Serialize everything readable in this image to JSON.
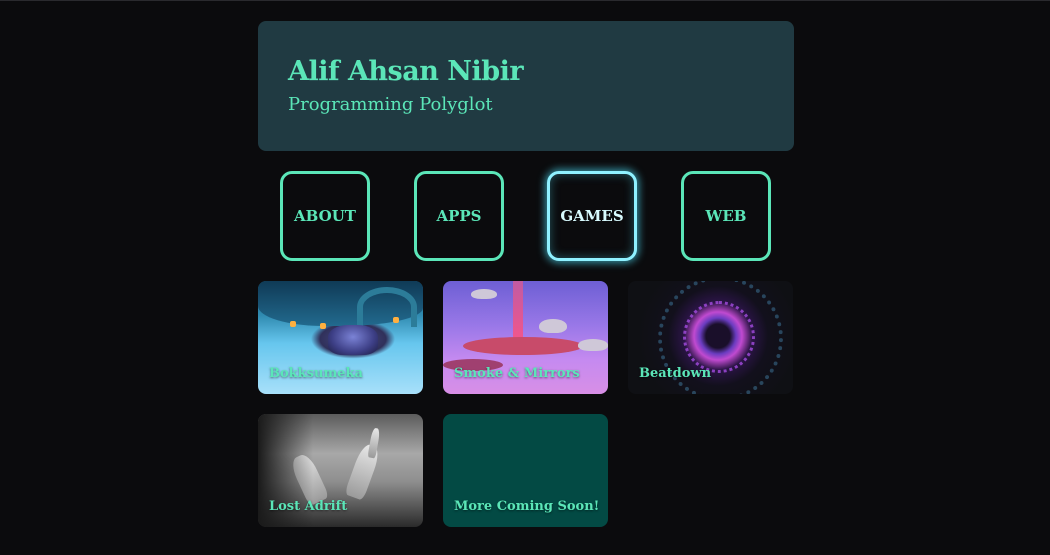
{
  "header": {
    "name": "Alif Ahsan Nibir",
    "tagline": "Programming Polyglot"
  },
  "nav": {
    "items": [
      {
        "label": "ABOUT",
        "active": false
      },
      {
        "label": "APPS",
        "active": false
      },
      {
        "label": "GAMES",
        "active": true
      },
      {
        "label": "WEB",
        "active": false
      }
    ]
  },
  "games": {
    "items": [
      {
        "title": "Bokksumeka"
      },
      {
        "title": "Smoke & Mirrors"
      },
      {
        "title": "Beatdown"
      },
      {
        "title": "Lost Adrift"
      },
      {
        "title": "More Coming Soon!"
      }
    ]
  },
  "colors": {
    "accent": "#5be6b8",
    "active_glow": "#8ff1ff",
    "header_bg": "#203a42",
    "page_bg": "#0b0b0d",
    "soon_card_bg": "#034a44"
  }
}
